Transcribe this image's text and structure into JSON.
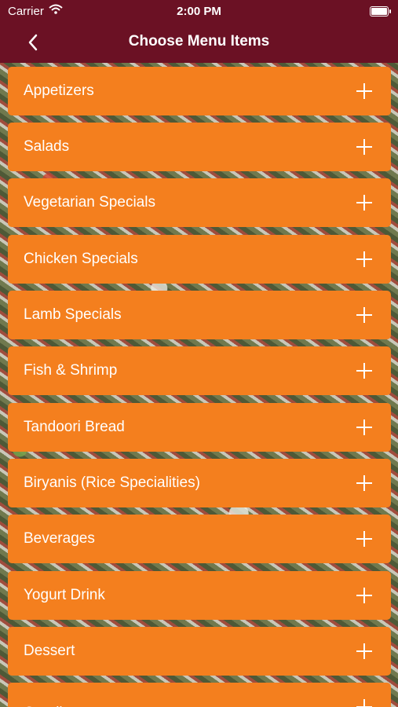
{
  "status_bar": {
    "carrier": "Carrier",
    "time": "2:00 PM",
    "icons": [
      "wifi-icon",
      "battery-icon"
    ]
  },
  "nav_bar": {
    "back_icon": "chevron-left-icon",
    "title": "Choose Menu Items"
  },
  "menu": {
    "items": [
      {
        "label": "Appetizers"
      },
      {
        "label": "Salads"
      },
      {
        "label": "Vegetarian Specials"
      },
      {
        "label": "Chicken Specials"
      },
      {
        "label": "Lamb Specials"
      },
      {
        "label": "Fish & Shrimp"
      },
      {
        "label": "Tandoori Bread"
      },
      {
        "label": "Biryanis (Rice Specialities)"
      },
      {
        "label": "Beverages"
      },
      {
        "label": "Yogurt Drink"
      },
      {
        "label": "Dessert"
      },
      {
        "label": "Condiments"
      }
    ],
    "expand_icon": "plus-icon"
  },
  "colors": {
    "nav_background": "#6b1124",
    "item_background": "#f47f1e",
    "text": "#ffffff"
  }
}
